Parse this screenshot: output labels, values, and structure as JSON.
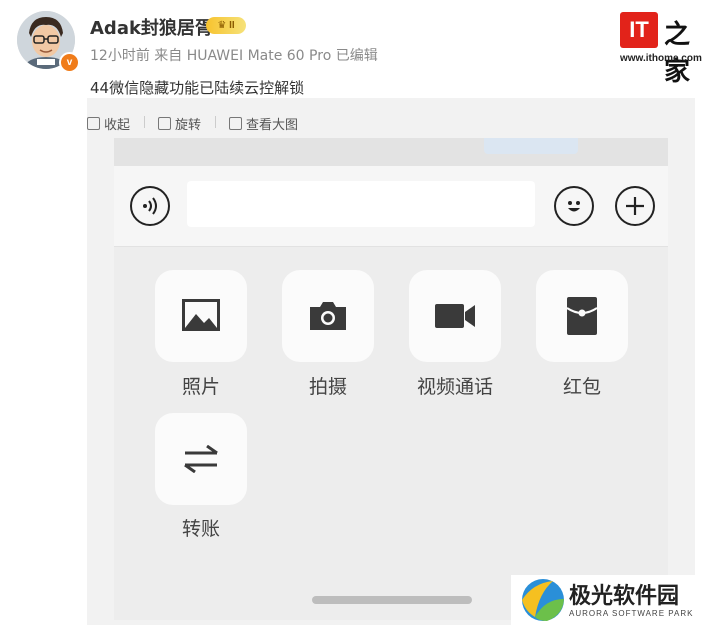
{
  "post": {
    "username": "Adak封狼居胥",
    "vip_badge": "II",
    "verified_badge": "v",
    "meta": "12小时前 来自 HUAWEI Mate 60 Pro 已编辑",
    "text": "44微信隐藏功能已陆续云控解锁"
  },
  "toolbar": {
    "collapse": "收起",
    "rotate": "旋转",
    "view_large": "查看大图"
  },
  "site_logo": {
    "mark": "IT",
    "zhi": "之家",
    "url": "www.ithome.com"
  },
  "phone": {
    "tiles": [
      {
        "label": "照片",
        "icon": "image-icon"
      },
      {
        "label": "拍摄",
        "icon": "camera-icon"
      },
      {
        "label": "视频通话",
        "icon": "video-camera-icon"
      },
      {
        "label": "红包",
        "icon": "red-packet-icon"
      },
      {
        "label": "转账",
        "icon": "transfer-icon"
      }
    ]
  },
  "watermark": {
    "name": "极光软件园",
    "subtitle": "AURORA SOFTWARE PARK"
  },
  "colors": {
    "ithome_red": "#e2231a",
    "verified_orange": "#f07c1a",
    "panel_gray": "#f2f2f2"
  }
}
